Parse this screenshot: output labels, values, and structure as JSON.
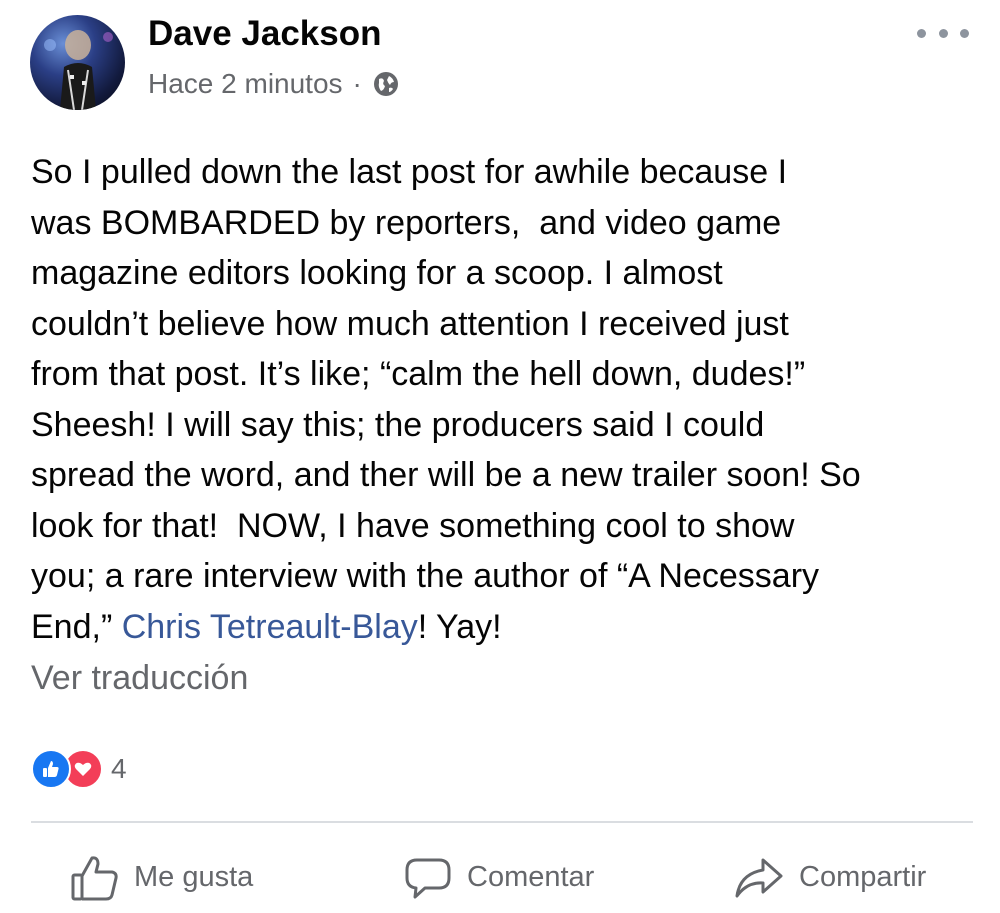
{
  "post": {
    "author": "Dave Jackson",
    "timestamp": "Hace 2 minutos",
    "separator": "·",
    "privacy_icon": "globe-icon",
    "text_before_mention": "So I pulled down the last post for awhile because I\nwas BOMBARDED by reporters,  and video game\nmagazine editors looking for a scoop. I almost\ncouldn’t believe how much attention I received just\nfrom that post. It’s like; “calm the hell down, dudes!”\nSheesh! I will say this; the producers said I could\nspread the word, and ther will be a new trailer soon! So\nlook for that!  NOW, I have something cool to show\nyou; a rare interview with the author of “A Necessary\nEnd,” ",
    "mention": "Chris Tetreault-Blay",
    "text_after_mention": "! Yay!",
    "see_translation": "Ver traducción"
  },
  "reactions": {
    "count": "4",
    "types": [
      "like-icon",
      "love-icon"
    ]
  },
  "actions": {
    "like": "Me gusta",
    "comment": "Comentar",
    "share": "Compartir"
  },
  "colors": {
    "link": "#385898",
    "secondary_text": "#65676b",
    "like_blue": "#1877f2",
    "love_red": "#f33e58"
  }
}
